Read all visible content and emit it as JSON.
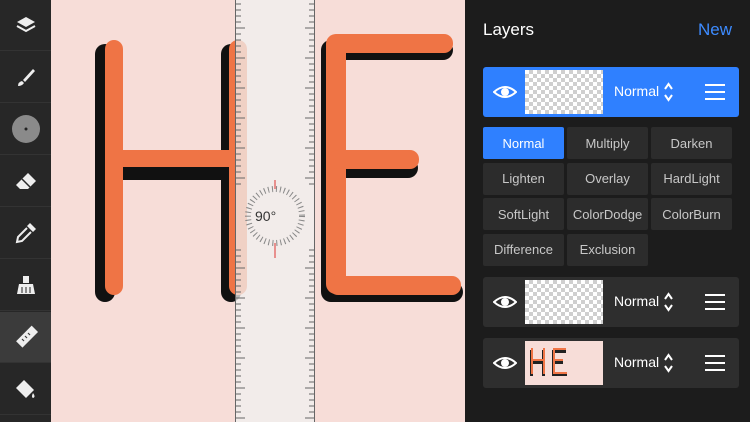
{
  "toolbar": {
    "tools": [
      {
        "name": "layers-tool-icon",
        "active": false
      },
      {
        "name": "brush-icon",
        "active": false
      },
      {
        "name": "brush-size-icon",
        "active": false
      },
      {
        "name": "eraser-icon",
        "active": false
      },
      {
        "name": "eyedropper-icon",
        "active": false
      },
      {
        "name": "smudge-icon",
        "active": false
      },
      {
        "name": "ruler-icon",
        "active": true
      },
      {
        "name": "fill-bucket-icon",
        "active": false
      }
    ]
  },
  "canvas": {
    "protractor_label": "90°",
    "letters": "HE"
  },
  "layers_panel": {
    "title": "Layers",
    "new_label": "New",
    "layers": [
      {
        "blend": "Normal",
        "selected": true,
        "thumb": "empty"
      },
      {
        "blend": "Normal",
        "selected": false,
        "thumb": "empty"
      },
      {
        "blend": "Normal",
        "selected": false,
        "thumb": "HE"
      }
    ],
    "blend_modes": [
      "Normal",
      "Multiply",
      "Darken",
      "Lighten",
      "Overlay",
      "HardLight",
      "SoftLight",
      "ColorDodge",
      "ColorBurn",
      "Difference",
      "Exclusion"
    ],
    "active_mode": "Normal"
  },
  "colors": {
    "accent": "#2f80ff",
    "letter_fill": "#ef7445",
    "canvas_bg": "#f7ddd8"
  }
}
